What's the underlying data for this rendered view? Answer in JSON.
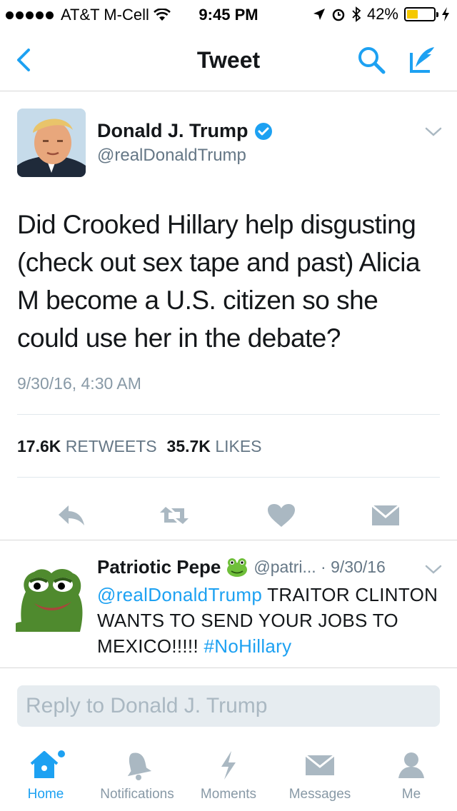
{
  "status_bar": {
    "carrier": "AT&T M-Cell",
    "time": "9:45 PM",
    "battery_percent": "42%",
    "battery_level": 0.42
  },
  "nav": {
    "title": "Tweet",
    "icons": [
      "back-icon",
      "search-icon",
      "compose-icon"
    ]
  },
  "tweet": {
    "author_name": "Donald J. Trump",
    "author_handle": "@realDonaldTrump",
    "verified": true,
    "text": "Did Crooked Hillary help disgusting (check out sex tape and past) Alicia M become a U.S. citizen so she could use her in the debate?",
    "timestamp": "9/30/16, 4:30 AM",
    "retweets_count": "17.6K",
    "retweets_label": "RETWEETS",
    "likes_count": "35.7K",
    "likes_label": "LIKES"
  },
  "reply": {
    "author_name": "Patriotic Pepe",
    "handle_date": "@patri... · 9/30/16",
    "mention": "@realDonaldTrump",
    "text": "TRAITOR CLINTON WANTS TO SEND YOUR JOBS TO MEXICO!!!!!",
    "hashtag": "#NoHillary"
  },
  "reply_box": {
    "placeholder": "Reply to Donald J. Trump"
  },
  "tabs": [
    {
      "label": "Home",
      "icon": "home-icon",
      "active": true
    },
    {
      "label": "Notifications",
      "icon": "bell-icon",
      "active": false
    },
    {
      "label": "Moments",
      "icon": "lightning-icon",
      "active": false
    },
    {
      "label": "Messages",
      "icon": "envelope-icon",
      "active": false
    },
    {
      "label": "Me",
      "icon": "person-icon",
      "active": false
    }
  ],
  "colors": {
    "accent": "#1da1f2",
    "icon_gray": "#aab8c2",
    "battery": "#f5c800"
  }
}
